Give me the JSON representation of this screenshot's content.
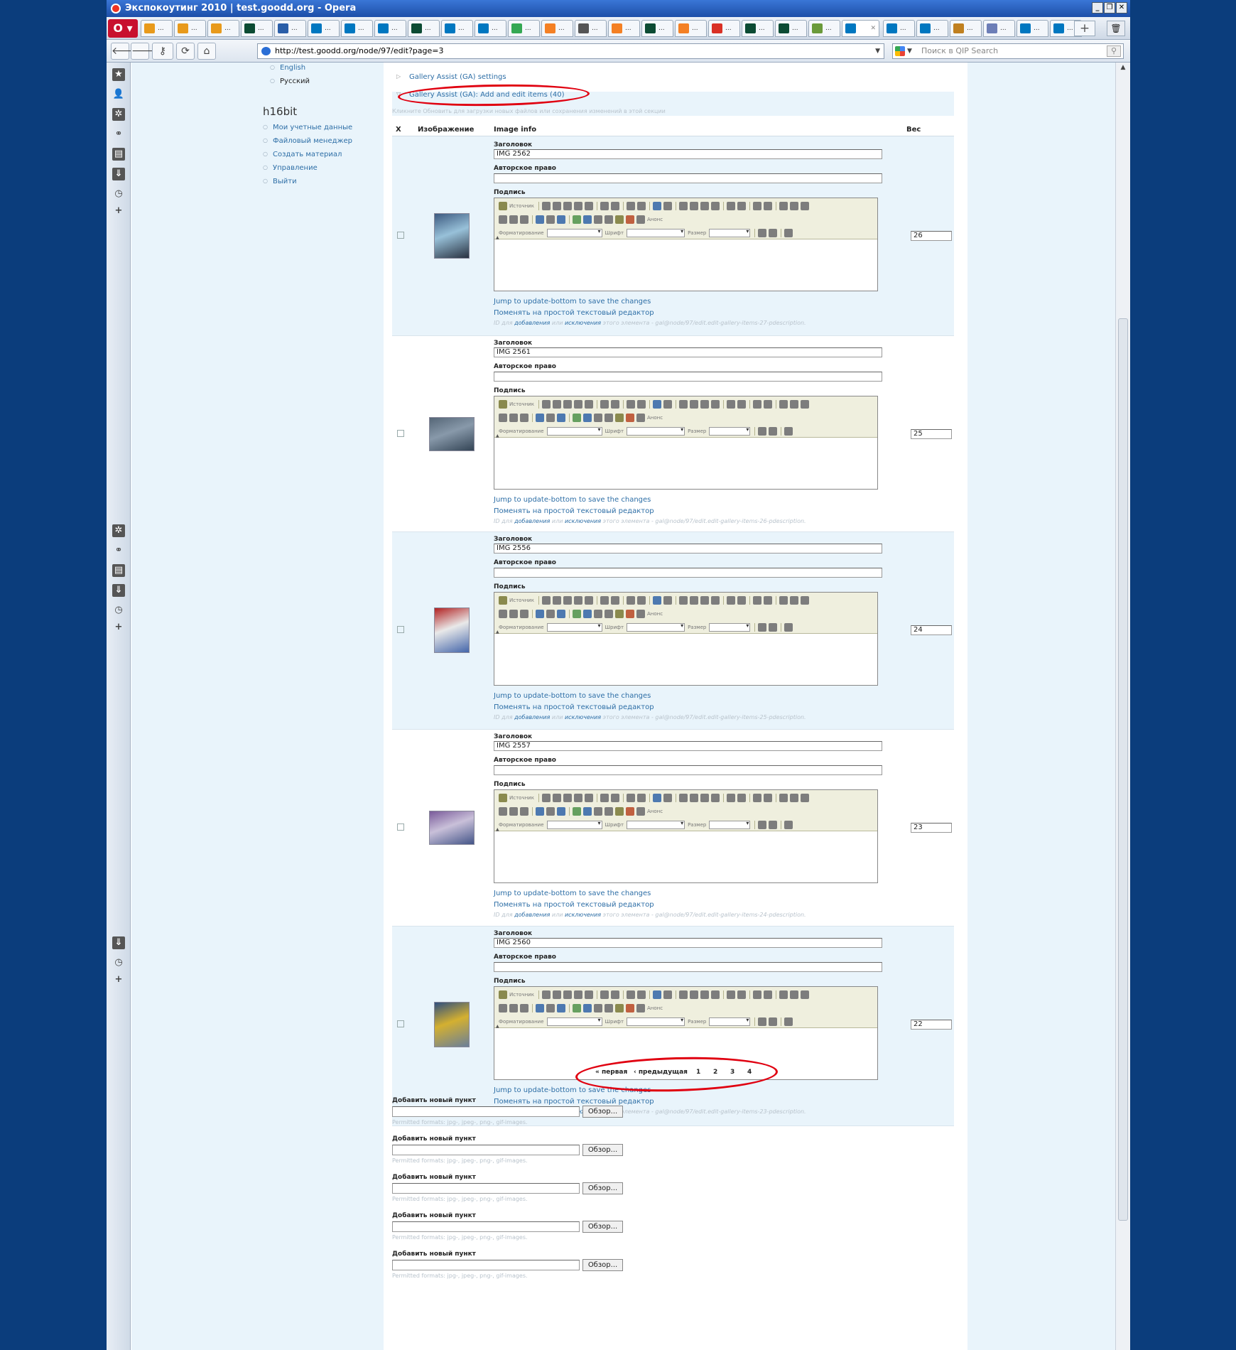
{
  "window": {
    "title": "Экспокоутинг 2010 | test.goodd.org - Opera"
  },
  "tabs": [
    {
      "label": "...",
      "icon": "pma-icon",
      "color": "#e89a1c"
    },
    {
      "label": "...",
      "icon": "pma-icon",
      "color": "#e89a1c"
    },
    {
      "label": "...",
      "icon": "pma-icon",
      "color": "#e89a1c"
    },
    {
      "label": "...",
      "icon": "django-icon",
      "color": "#0c4b33"
    },
    {
      "label": "...",
      "icon": "chat-icon",
      "color": "#2a5ea8"
    },
    {
      "label": "...",
      "icon": "drupal-icon",
      "color": "#0077c0"
    },
    {
      "label": "...",
      "icon": "drupal-icon",
      "color": "#0077c0"
    },
    {
      "label": "...",
      "icon": "drupal-icon",
      "color": "#0077c0"
    },
    {
      "label": "...",
      "icon": "django-icon",
      "color": "#0c4b33"
    },
    {
      "label": "...",
      "icon": "drupal-icon",
      "color": "#0077c0"
    },
    {
      "label": "...",
      "icon": "drupal-icon",
      "color": "#0077c0"
    },
    {
      "label": "...",
      "icon": "google-icon",
      "color": "#34a853"
    },
    {
      "label": "...",
      "icon": "stack-icon",
      "color": "#f48024"
    },
    {
      "label": "...",
      "icon": "cog-icon",
      "color": "#555555"
    },
    {
      "label": "...",
      "icon": "stack-icon",
      "color": "#f48024"
    },
    {
      "label": "...",
      "icon": "django-icon",
      "color": "#0c4b33"
    },
    {
      "label": "...",
      "icon": "stack-icon",
      "color": "#f48024"
    },
    {
      "label": "...",
      "icon": "gmail-icon",
      "color": "#d93025"
    },
    {
      "label": "...",
      "icon": "django-icon",
      "color": "#0c4b33"
    },
    {
      "label": "...",
      "icon": "django-icon",
      "color": "#0c4b33"
    },
    {
      "label": "...",
      "icon": "image-icon",
      "color": "#6a9a3a"
    },
    {
      "label": "",
      "icon": "drupal-icon",
      "color": "#0077c0",
      "active": true
    },
    {
      "label": "...",
      "icon": "drupal-icon",
      "color": "#0077c0"
    },
    {
      "label": "...",
      "icon": "drupal-icon",
      "color": "#0077c0"
    },
    {
      "label": "...",
      "icon": "download-icon",
      "color": "#c08020"
    },
    {
      "label": "...",
      "icon": "php-icon",
      "color": "#6c7eb7"
    },
    {
      "label": "...",
      "icon": "drupal-icon",
      "color": "#0077c0"
    },
    {
      "label": "...",
      "icon": "drupal-icon",
      "color": "#0077c0"
    }
  ],
  "address": {
    "url": "http://test.goodd.org/node/97/edit?page=3"
  },
  "search": {
    "placeholder": "Поиск в QIP Search"
  },
  "sidebar": {
    "languages": [
      "English",
      "Русский"
    ],
    "user_title": "h16bit",
    "links": [
      "Мои учетные данные",
      "Файловый менеджер",
      "Создать материал",
      "Управление",
      "Выйти"
    ]
  },
  "ga": {
    "settings_legend": "Gallery Assist (GA) settings",
    "items_legend": "Gallery Assist (GA): Add and edit items (40)",
    "help": "Кликните Обновить для загрузки новых файлов или сохранения изменений в этой секции",
    "headers": {
      "x": "X",
      "image": "Изображение",
      "info": "Image info",
      "weight": "Вес"
    },
    "labels": {
      "title": "Заголовок",
      "copyright": "Авторское право",
      "caption": "Подпись",
      "jump": "Jump to update-bottom to save the changes",
      "switch": "Поменять на простой текстовый редактор",
      "id_prefix": "ID для",
      "id_add": "добавления",
      "id_or": "или",
      "id_excl": "исключения",
      "id_suffix": "этого элемента -"
    },
    "toolbar": {
      "source": "Источник",
      "format": "Форматирование",
      "font": "Шрифт",
      "size": "Размер",
      "anchor": "Анонс"
    },
    "items": [
      {
        "title": "IMG 2562",
        "copyright": "",
        "weight": "26",
        "id": "gal@node/97/edit.edit-gallery-items-27-pdescription."
      },
      {
        "title": "IMG 2561",
        "copyright": "",
        "weight": "25",
        "id": "gal@node/97/edit.edit-gallery-items-26-pdescription."
      },
      {
        "title": "IMG 2556",
        "copyright": "",
        "weight": "24",
        "id": "gal@node/97/edit.edit-gallery-items-25-pdescription."
      },
      {
        "title": "IMG 2557",
        "copyright": "",
        "weight": "23",
        "id": "gal@node/97/edit.edit-gallery-items-24-pdescription."
      },
      {
        "title": "IMG 2560",
        "copyright": "",
        "weight": "22",
        "id": "gal@node/97/edit.edit-gallery-items-23-pdescription."
      }
    ]
  },
  "pager": {
    "first": "« первая",
    "prev": "‹ предыдущая",
    "pages": [
      "1",
      "2",
      "3",
      "4"
    ]
  },
  "add_items": {
    "label": "Добавить новый пункт",
    "browse": "Обзор...",
    "permitted": "Permitted formats: jpg-, jpeg-, png-, gif-images."
  },
  "colors": {
    "accent": "#2d6ea6",
    "annotation": "#e00010",
    "page_bg": "#e9f4fb"
  }
}
